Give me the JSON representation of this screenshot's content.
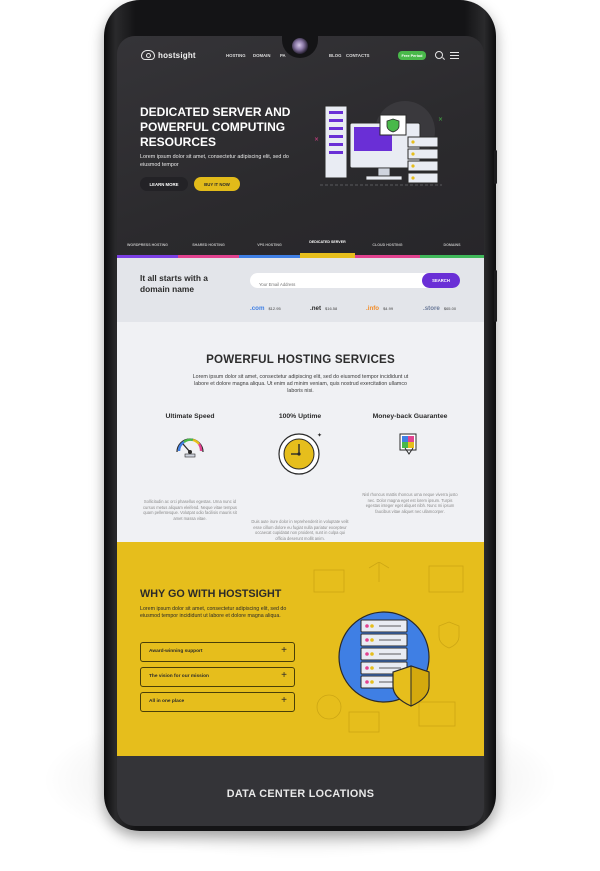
{
  "nav": {
    "logo": "hostsight",
    "items": [
      "HOSTING",
      "DOMAIN",
      "PA",
      "BLOG",
      "CONTACTS"
    ],
    "cta": "Free Period"
  },
  "hero": {
    "title": "DEDICATED SERVER AND POWERFUL COMPUTING RESOURCES",
    "subtitle": "Lorem ipsum dolor sit amet, consectetur adipiscing elit, sed do eiusmod tempor",
    "learn_more": "LEARN MORE",
    "buy_now": "BUY IT NOW"
  },
  "tabs": [
    {
      "label": "WORDPRESS HOSTING",
      "color": "#7b3fe4"
    },
    {
      "label": "SHARED HOSTING",
      "color": "#e2428f"
    },
    {
      "label": "VPS HOSTING",
      "color": "#3f7fe4"
    },
    {
      "label": "DEDICATED SERVER",
      "color": "#e6be1c"
    },
    {
      "label": "CLOUD HOSTING",
      "color": "#e2428f"
    },
    {
      "label": "DOMAINS",
      "color": "#3fb85a"
    }
  ],
  "domain": {
    "title": "It all starts with a domain name",
    "placeholder": "Your Email Address",
    "button": "SEARCH",
    "tlds": [
      {
        "ext": ".com",
        "price": "$12.95",
        "color": "#3f7fe4"
      },
      {
        "ext": ".net",
        "price": "$16.58",
        "color": "#2b2b2b"
      },
      {
        "ext": ".info",
        "price": "$4.99",
        "color": "#f28c28"
      },
      {
        "ext": ".store",
        "price": "$65.00",
        "color": "#6b7a99"
      }
    ]
  },
  "services": {
    "title": "POWERFUL HOSTING SERVICES",
    "subtitle": "Lorem ipsum dolor sit amet, consectetur adipiscing elit, sed do eiusmod tempor incididunt ut labore et dolore magna aliqua. Ut enim ad minim veniam, quis nostrud exercitation ullamco laboris nisi.",
    "features": [
      {
        "title": "Ultimate Speed",
        "text": "Sollicitudin ac orci phasellus egestas. Urna nunc id cursus metus aliquam eleifend. Neque vitae tempus quam pellentesque. Volutpat odio facilisis mauris sit amet massa vitae.",
        "icon": "speedometer-icon"
      },
      {
        "title": "100% Uptime",
        "text": "Duis aute irure dolor in reprehenderit in voluptate velit esse cillum dolore eu fugiat nulla pariatur excepteur occaecat cupidatat non proident, sunt in culpa qui officia deserunt mollit anim.",
        "icon": "clock-icon"
      },
      {
        "title": "Money-back Guarantee",
        "text": "Nisl rhoncus mattis rhoncus urna neque viverra justo nec. Dolor magna eget est lorem ipsum. Turpis egestas integer eget aliquet nibh. Nunc mi ipsum faucibus vitae aliquet nec ullamcorper.",
        "icon": "money-back-icon"
      }
    ]
  },
  "why": {
    "title": "WHY GO WITH HOSTSIGHT",
    "subtitle": "Lorem ipsum dolor sit amet, consectetur adipiscing elit, sed do eiusmod tempor incididunt ut labore et dolore magna aliqua.",
    "items": [
      "Award-winning support",
      "The vision for our mission",
      "All in one place"
    ]
  },
  "datacenter": {
    "title": "DATA CENTER LOCATIONS"
  }
}
